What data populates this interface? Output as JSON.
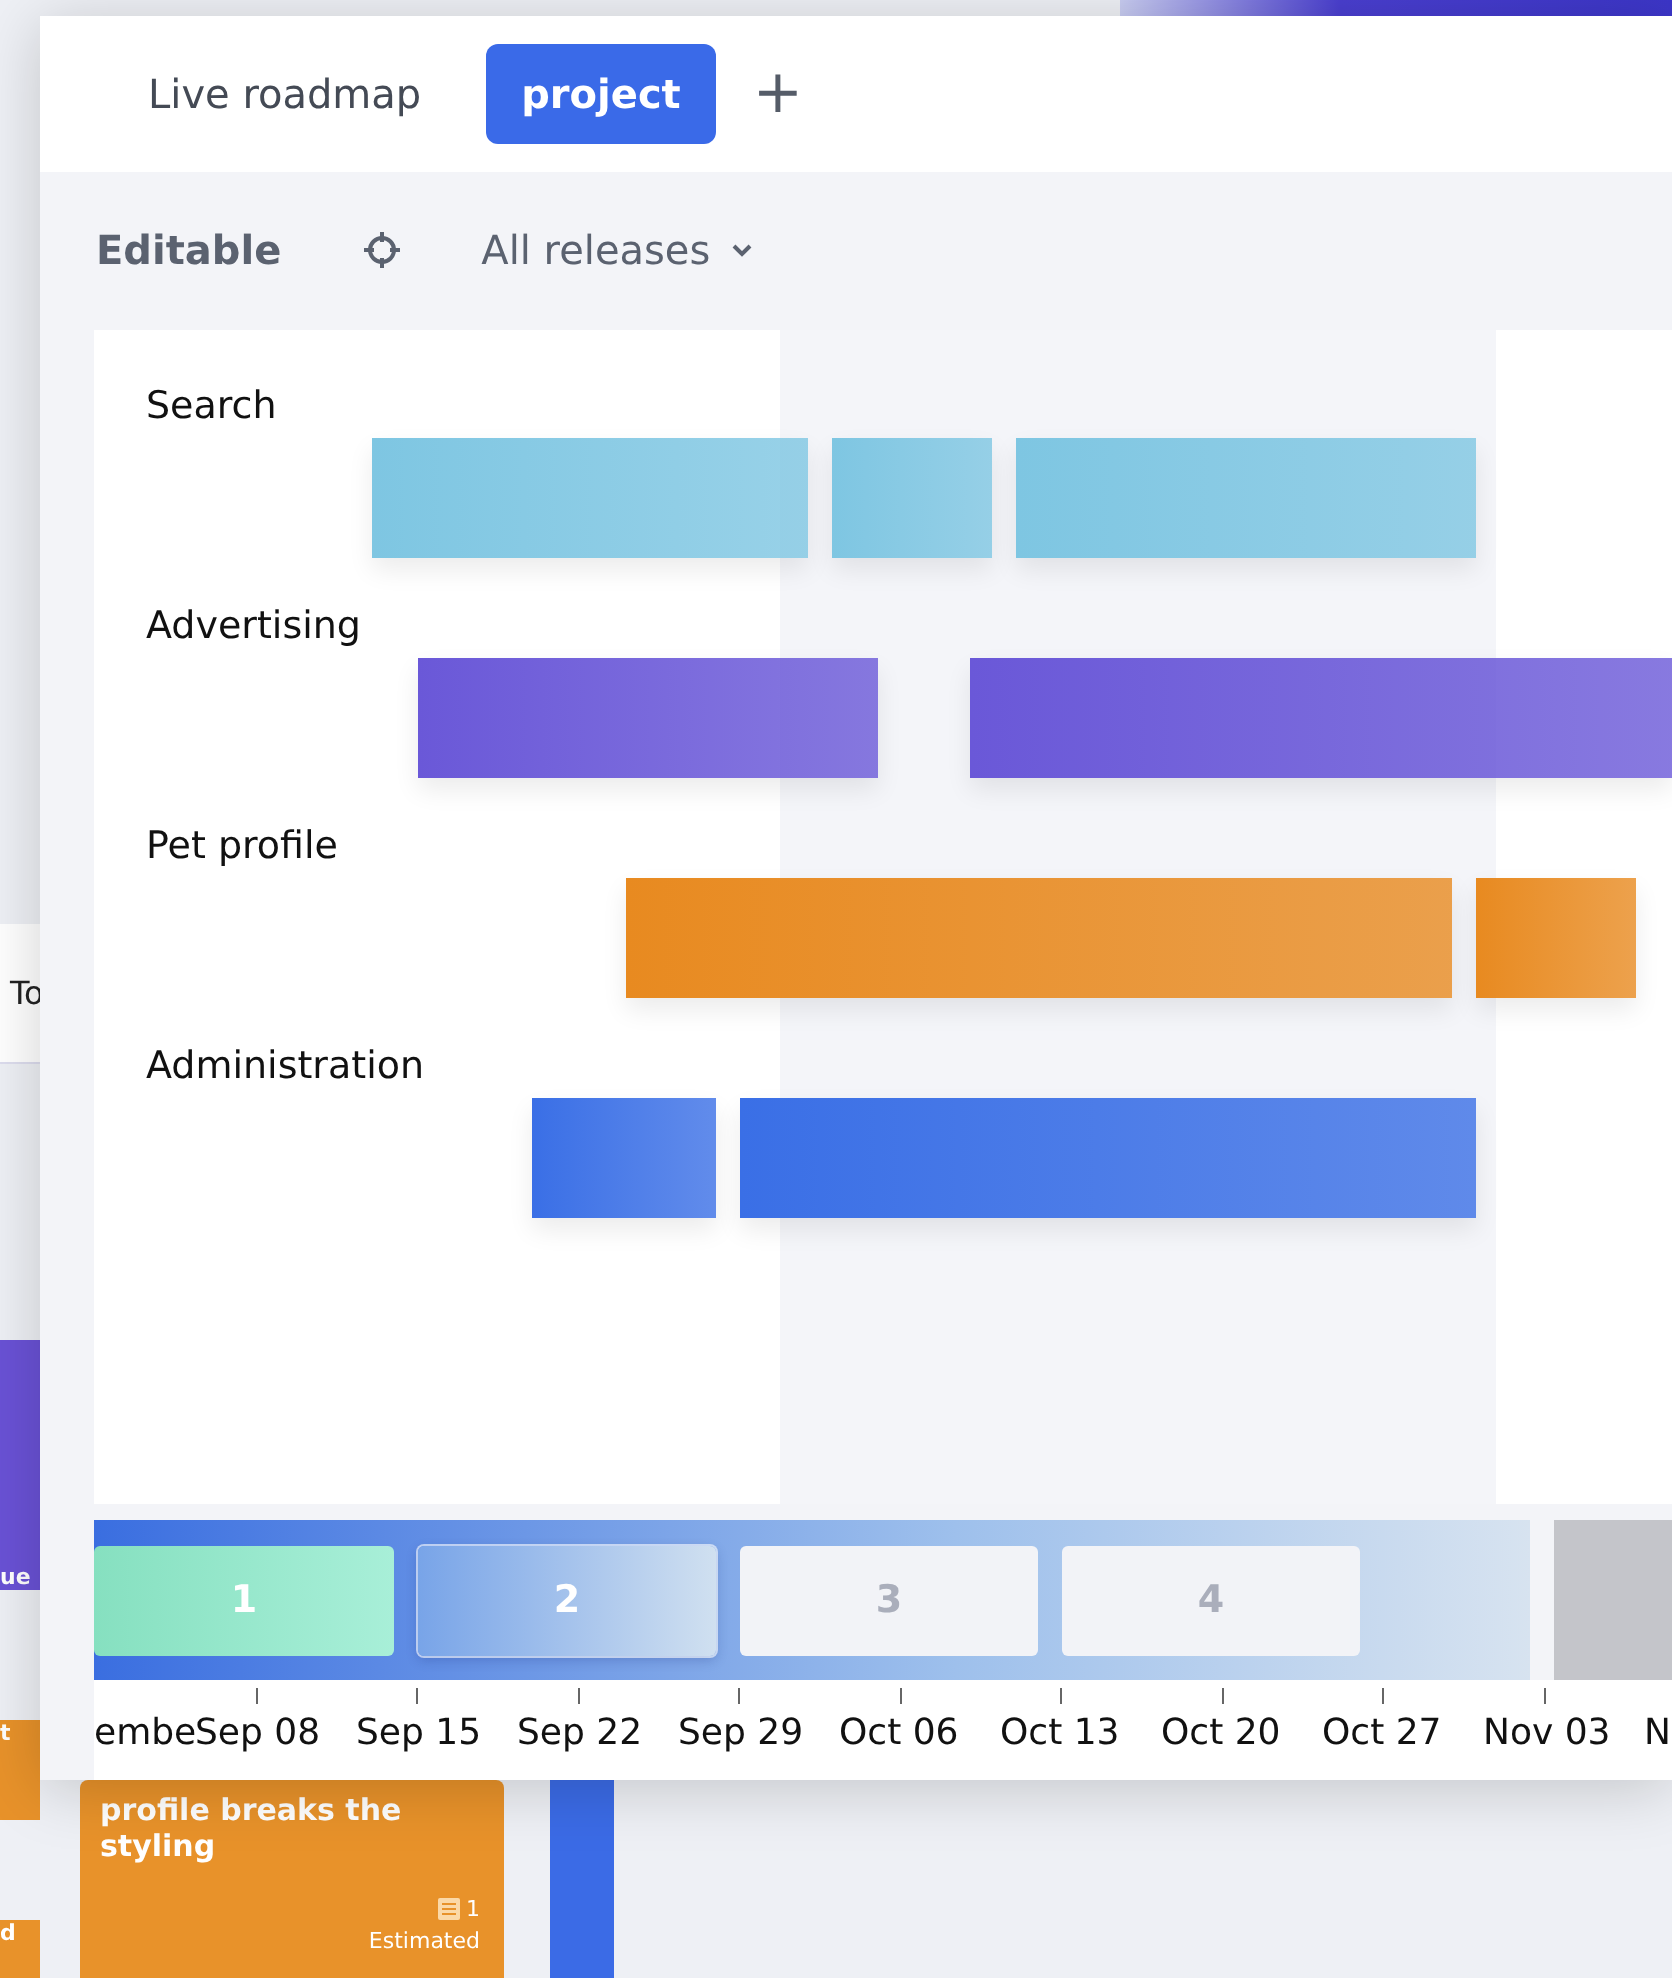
{
  "background_board": {
    "column_tab": "To",
    "cards": [
      {
        "kind": "side",
        "color": "#6a52d6",
        "text": "ue"
      },
      {
        "kind": "side",
        "color": "#e8922a",
        "text": "t"
      },
      {
        "kind": "side",
        "color": "#e8922a",
        "text": "d"
      },
      {
        "kind": "card",
        "color": "#e8922a",
        "title": "profile breaks the styling",
        "count": "1",
        "estimate": "Estimated"
      }
    ]
  },
  "tabs": [
    {
      "label": "Live roadmap",
      "selected": false
    },
    {
      "label": "project",
      "selected": true
    }
  ],
  "add_tab": "+",
  "toolbar": {
    "mode": "Editable",
    "release_filter": "All releases"
  },
  "lanes": [
    {
      "name": "Search",
      "color": "#7ec6e2"
    },
    {
      "name": "Advertising",
      "color": "#6a58d8"
    },
    {
      "name": "Pet profile",
      "color": "#e88a20"
    },
    {
      "name": "Administration",
      "color": "#3a6fe6"
    }
  ],
  "releases": [
    {
      "label": "1",
      "completed": true,
      "selected": false
    },
    {
      "label": "2",
      "completed": false,
      "selected": true
    },
    {
      "label": "3",
      "completed": false,
      "selected": false
    },
    {
      "label": "4",
      "completed": false,
      "selected": false
    }
  ],
  "axis_labels": [
    "embe",
    "Sep 08",
    "Sep 15",
    "Sep 22",
    "Sep 29",
    "Oct 06",
    "Oct 13",
    "Oct 20",
    "Oct 27",
    "Nov 03",
    "N"
  ]
}
